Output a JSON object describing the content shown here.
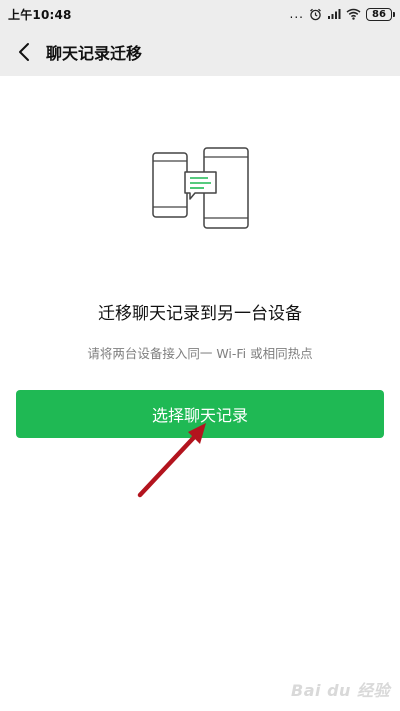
{
  "status_bar": {
    "time": "上午10:48",
    "dots": "...",
    "battery": "86"
  },
  "header": {
    "title": "聊天记录迁移"
  },
  "main": {
    "heading": "迁移聊天记录到另一台设备",
    "subtitle": "请将两台设备接入同一 Wi-Fi 或相同热点",
    "select_button_label": "选择聊天记录"
  },
  "colors": {
    "accent": "#1fb954",
    "arrow": "#b3141e",
    "header_bg": "#ededed"
  },
  "watermark": "Bai du 经验"
}
